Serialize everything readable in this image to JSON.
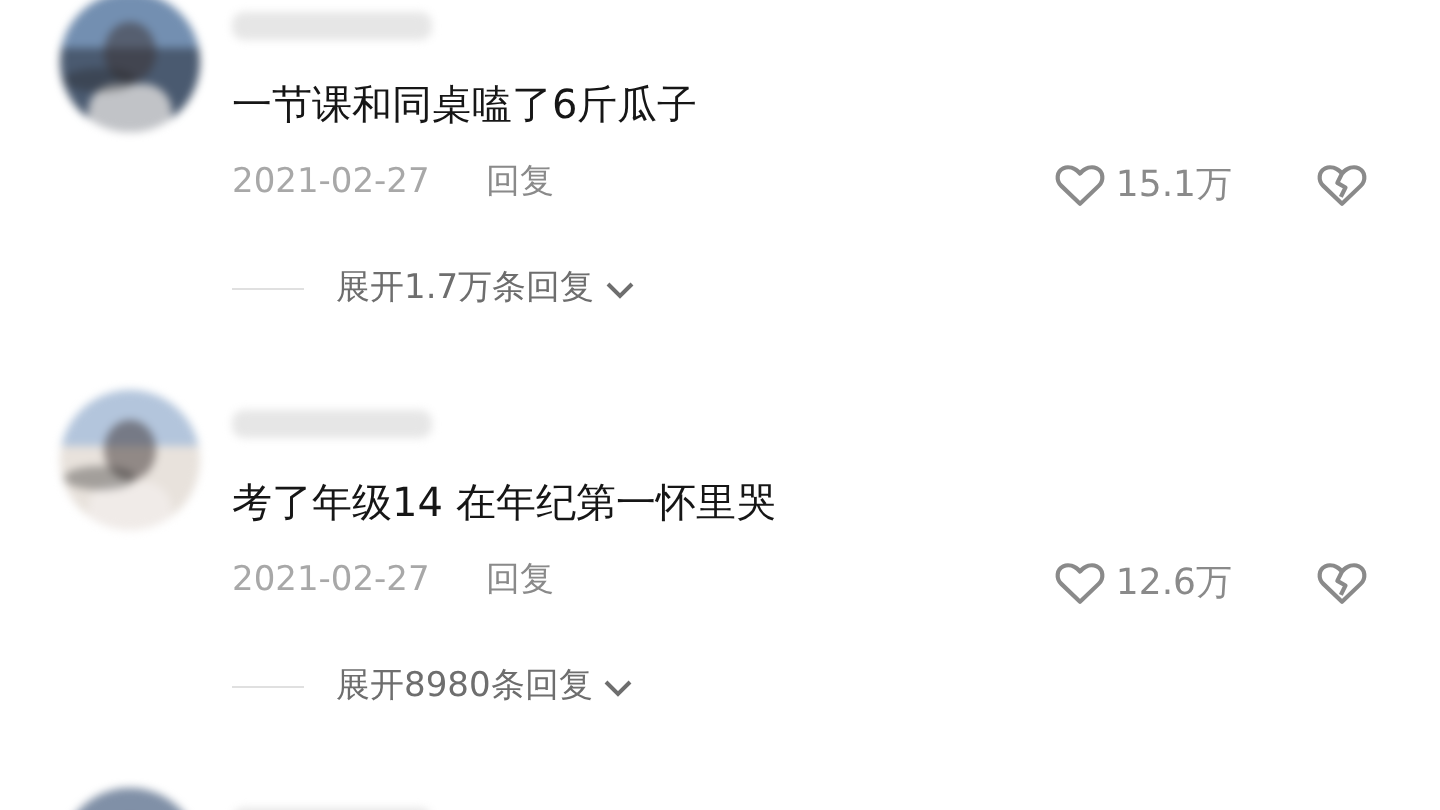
{
  "comments": [
    {
      "kind": "full",
      "text": "一节课和同桌嗑了6斤瓜子",
      "date": "2021-02-27",
      "reply": "回复",
      "likes": "15.1万",
      "expand": "展开1.7万条回复"
    },
    {
      "kind": "full",
      "text": "考了年级14 在年纪第一怀里哭",
      "date": "2021-02-27",
      "reply": "回复",
      "likes": "12.6万",
      "expand": "展开8980条回复"
    },
    {
      "kind": "peek"
    }
  ]
}
